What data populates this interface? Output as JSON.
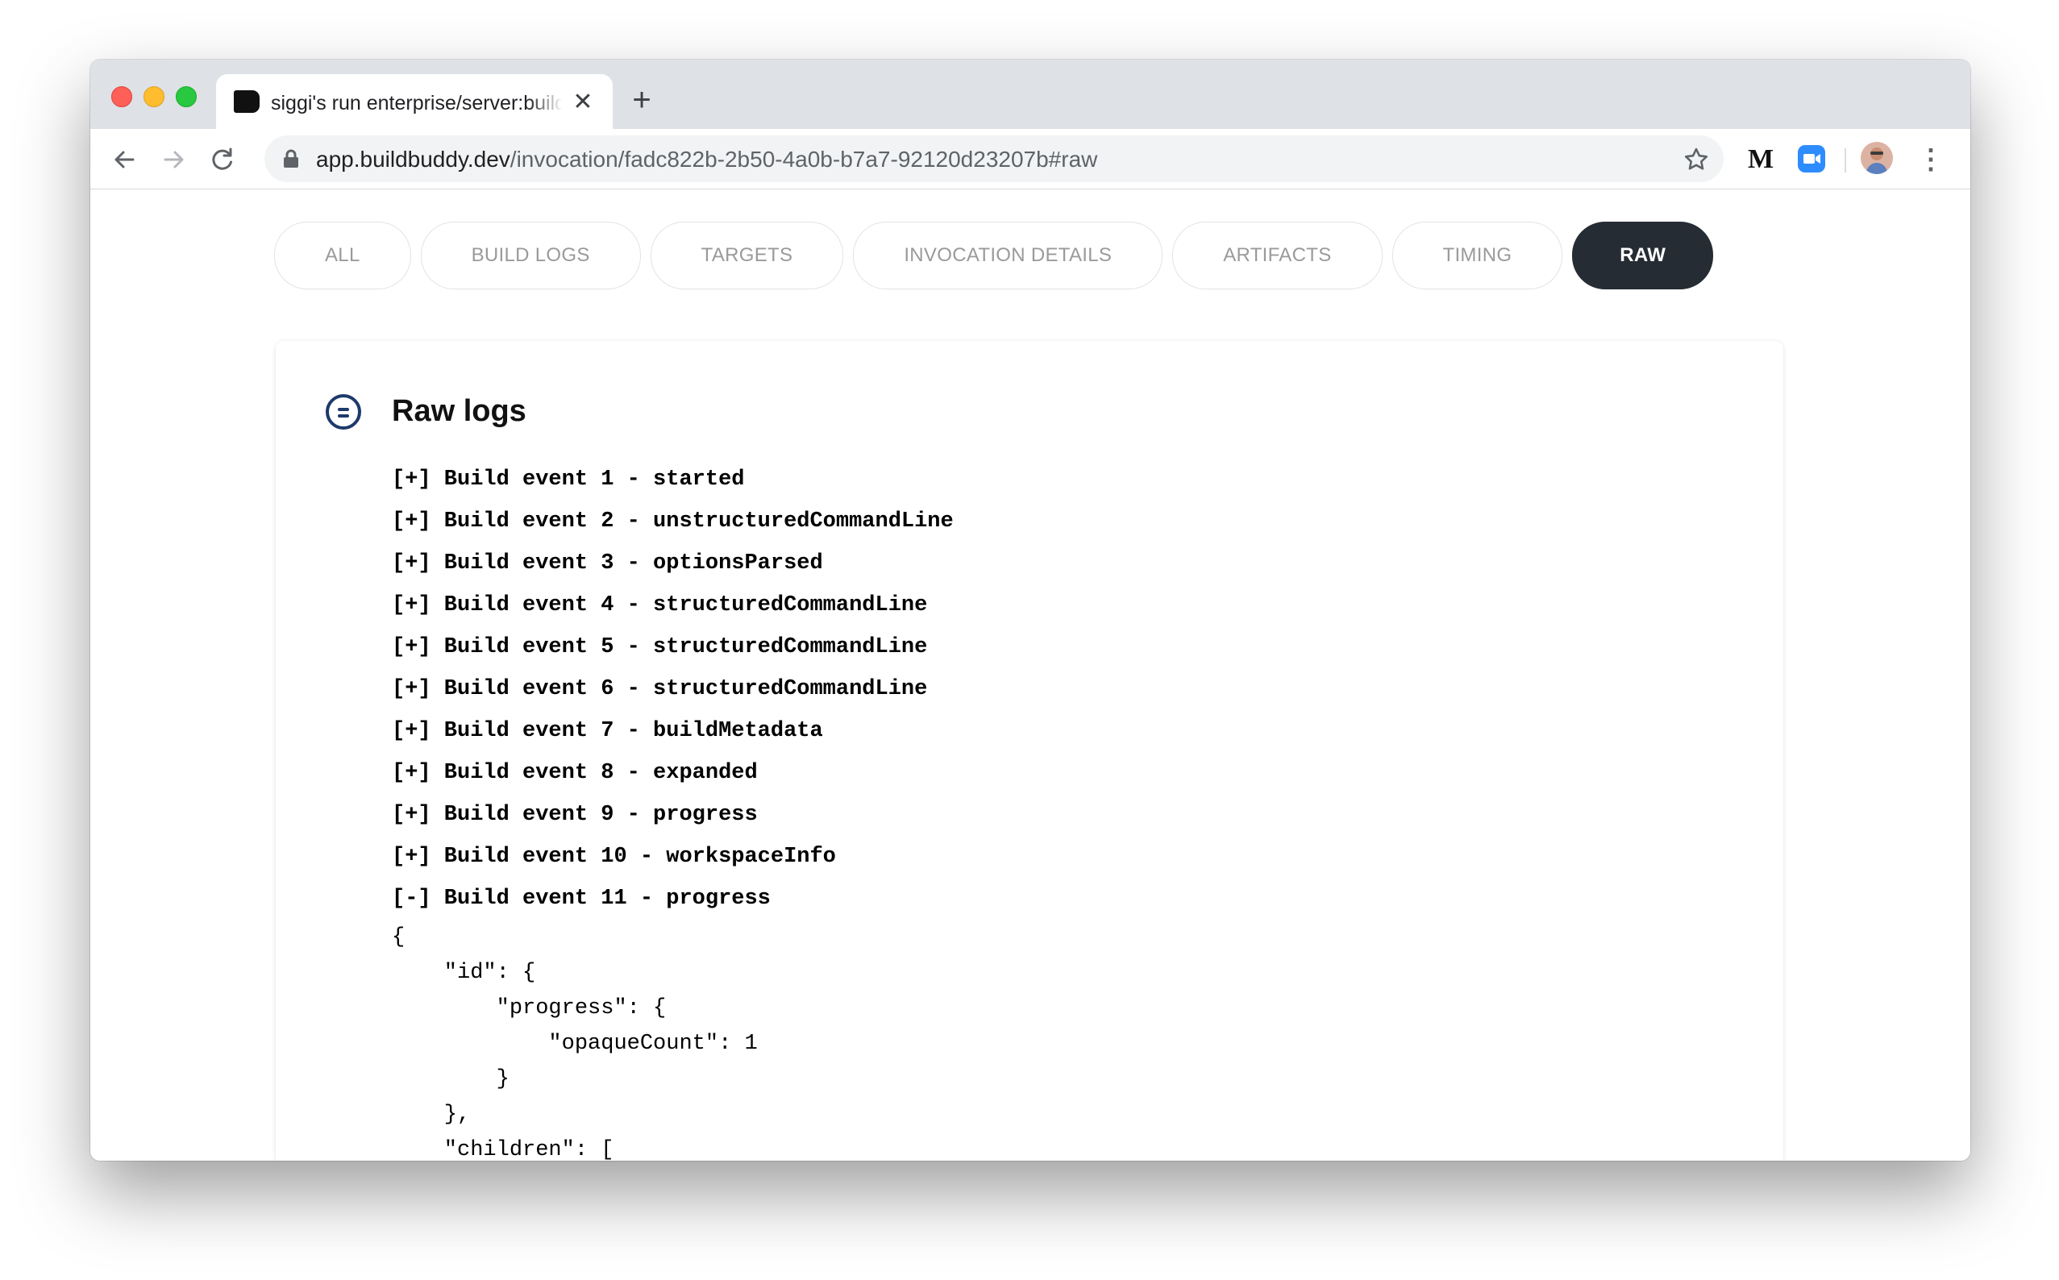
{
  "browser": {
    "tab_title": "siggi's run enterprise/server:buildbuddy",
    "tab_close": "✕",
    "new_tab": "+",
    "url_host": "app.buildbuddy.dev",
    "url_path": "/invocation/fadc822b-2b50-4a0b-b7a7-92120d23207b#raw",
    "extension_m": "M",
    "menu": "⋮"
  },
  "nav": {
    "tabs": [
      {
        "label": "ALL"
      },
      {
        "label": "BUILD LOGS"
      },
      {
        "label": "TARGETS"
      },
      {
        "label": "INVOCATION DETAILS"
      },
      {
        "label": "ARTIFACTS"
      },
      {
        "label": "TIMING"
      },
      {
        "label": "RAW"
      }
    ],
    "active": "RAW"
  },
  "card": {
    "title": "Raw logs",
    "events": [
      "[+] Build event 1 - started",
      "[+] Build event 2 - unstructuredCommandLine",
      "[+] Build event 3 - optionsParsed",
      "[+] Build event 4 - structuredCommandLine",
      "[+] Build event 5 - structuredCommandLine",
      "[+] Build event 6 - structuredCommandLine",
      "[+] Build event 7 - buildMetadata",
      "[+] Build event 8 - expanded",
      "[+] Build event 9 - progress",
      "[+] Build event 10 - workspaceInfo",
      "[-] Build event 11 - progress"
    ],
    "json": [
      "{",
      "    \"id\": {",
      "        \"progress\": {",
      "            \"opaqueCount\": 1",
      "        }",
      "    },",
      "    \"children\": ["
    ]
  }
}
